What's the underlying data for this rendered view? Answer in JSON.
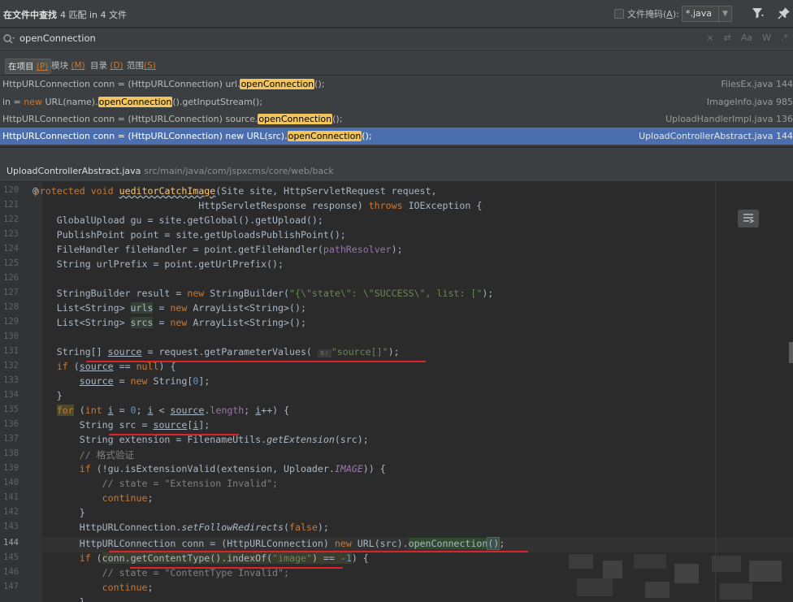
{
  "header": {
    "title_bold": "在文件中查找",
    "title_rest": "4 匹配 in 4 文件",
    "file_mask_label": "文件掩码(",
    "file_mask_key": "A",
    "file_mask_suffix": "):",
    "file_mask_value": "*.java"
  },
  "search": {
    "query": "openConnection",
    "tools": [
      "×",
      "⇄",
      "Aa",
      "W",
      ".*"
    ]
  },
  "scopes": [
    {
      "label": "在项目 ",
      "key": "(P)",
      "selected": true
    },
    {
      "label": "模块 ",
      "key": "(M)",
      "selected": false
    },
    {
      "label": "目录 ",
      "key": "(D)",
      "selected": false
    },
    {
      "label": "范围",
      "key": "(S)",
      "selected": false
    }
  ],
  "results": [
    {
      "pre": "HttpURLConnection conn = (HttpURLConnection) url.",
      "kw": "",
      "post_kw": "",
      "match": "openConnection",
      "post": "();",
      "loc": "FilesEx.java 144"
    },
    {
      "pre": "in = ",
      "kw": "new",
      "post_kw": " URL(name).",
      "match": "openConnection",
      "post": "().getInputStream();",
      "loc": "ImageInfo.java 985"
    },
    {
      "pre": "HttpURLConnection conn = (HttpURLConnection) source.",
      "kw": "",
      "post_kw": "",
      "match": "openConnection",
      "post": "();",
      "loc": "UploadHandlerImpl.java 136"
    },
    {
      "pre": "HttpURLConnection conn = (HttpURLConnection) new URL(src).",
      "kw": "",
      "post_kw": "",
      "match": "openConnection",
      "post": "();",
      "loc": "UploadControllerAbstract.java 144"
    }
  ],
  "file": {
    "name": "UploadControllerAbstract.java",
    "path": "src/main/java/com/jspxcms/core/web/back"
  },
  "editor": {
    "line_numbers": [
      "120",
      "121",
      "122",
      "123",
      "124",
      "125",
      "126",
      "127",
      "128",
      "129",
      "130",
      "131",
      "132",
      "133",
      "134",
      "135",
      "136",
      "137",
      "138",
      "139",
      "140",
      "141",
      "142",
      "143",
      "144",
      "145",
      "146",
      "147"
    ],
    "annotation": "@",
    "current_line": "144"
  },
  "colors": {
    "editor_bg": "#2b2b2b",
    "keyword": "#cc7832",
    "string": "#6a8759",
    "selection": "#4b6eaf",
    "match_highlight": "#f2c55c",
    "red_underline": "#e0222a"
  },
  "icons": [
    "filter-icon",
    "pin-icon",
    "search-icon",
    "doc-render-icon"
  ]
}
